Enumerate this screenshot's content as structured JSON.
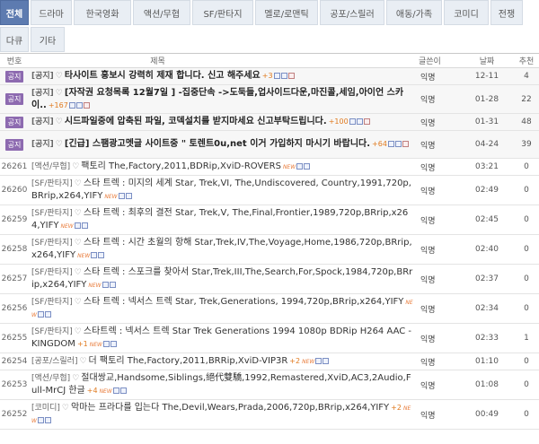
{
  "tabs": [
    [
      "전체",
      "드라마",
      "한국영화",
      "액션/무협",
      "SF/판타지",
      "멜로/로맨틱",
      "공포/스릴러",
      "애동/가족",
      "코미디",
      "전쟁"
    ],
    [
      "다큐",
      "기타"
    ]
  ],
  "header": {
    "no": "번호",
    "title": "제목",
    "author": "글쓴이",
    "date": "날짜",
    "views": "추천"
  },
  "rows": [
    {
      "no": "공지",
      "title": "타사이트 홍보시 강력히 제재 합니다. 신고 해주세요",
      "comments": "+3",
      "author": "익명",
      "date": "12-11",
      "views": "4",
      "notice": true
    },
    {
      "no": "공지",
      "title": "[자작권 요청목록 12월7일 ] -집중단속 ->도둑들,업사이드다운,마진콜,세임,아이언 스카이..",
      "comments": "+167",
      "author": "익명",
      "date": "01-28",
      "views": "22",
      "notice": true
    },
    {
      "no": "공지",
      "title": "시드파일중에 압축된 파일, 코덱설치를 받지마세요 신고부탁드립니다.",
      "comments": "+100",
      "author": "익명",
      "date": "01-31",
      "views": "48",
      "notice": true
    },
    {
      "no": "공지",
      "title": "[긴급] 스팸광고멧글 사이트중 \" 토렌트0u,net 이거 가입하지 마시기 바랍니다.",
      "comments": "+64",
      "author": "익명",
      "date": "04-24",
      "views": "39",
      "notice": true
    },
    {
      "no": "26261",
      "cat": "[액션/무협]",
      "title": "팩토리 The,Factory,2011,BDRip,XviD-ROVERS",
      "comments": "",
      "author": "익명",
      "date": "03:21",
      "views": "0"
    },
    {
      "no": "26260",
      "cat": "[SF/판타지]",
      "title": "스타 트렉 : 미지의 세계 Star, Trek,VI, The,Undiscovered, Country,1991,720p,BRrip,x264,YIFY",
      "comments": "",
      "author": "익명",
      "date": "02:49",
      "views": "0"
    },
    {
      "no": "26259",
      "cat": "[SF/판타지]",
      "title": "스타 트렉 : 최후의 결전 Star, Trek,V, The,Final,Frontier,1989,720p,BRrip,x264,YIFY",
      "comments": "",
      "author": "익명",
      "date": "02:45",
      "views": "0"
    },
    {
      "no": "26258",
      "cat": "[SF/판타지]",
      "title": "스타 트렉 : 시간 초월의 항해 Star,Trek,IV,The,Voyage,Home,1986,720p,BRrip,x264,YIFY",
      "comments": "",
      "author": "익명",
      "date": "02:40",
      "views": "0"
    },
    {
      "no": "26257",
      "cat": "[SF/판타지]",
      "title": "스타 트렉 : 스포크를 찾아서 Star,Trek,III,The,Search,For,Spock,1984,720p,BRrip,x264,YIFY",
      "comments": "",
      "author": "익명",
      "date": "02:37",
      "views": "0"
    },
    {
      "no": "26256",
      "cat": "[SF/판타지]",
      "title": "스타 트렉 : 넥서스 트렉 Star, Trek,Generations, 1994,720p,BRrip,x264,YIFY",
      "comments": "",
      "author": "익명",
      "date": "02:34",
      "views": "0"
    },
    {
      "no": "26255",
      "cat": "[SF/판타지]",
      "title": "스타트렉 : 넥서스 트렉 Star Trek Generations 1994 1080p BDRip H264 AAC - KINGDOM",
      "comments": "+1",
      "author": "익명",
      "date": "02:33",
      "views": "1"
    },
    {
      "no": "26254",
      "cat": "[공포/스릴러]",
      "title": "더 팩토리 The,Factory,2011,BRRip,XviD-VIP3R",
      "comments": "+2",
      "author": "익명",
      "date": "01:10",
      "views": "0"
    },
    {
      "no": "26253",
      "cat": "[액션/무협]",
      "title": "절대쌍교,Handsome,Siblings,絕代雙驕,1992,Remastered,XviD,AC3,2Audio,Full-MrCJ 한글",
      "comments": "+4",
      "author": "익명",
      "date": "01:08",
      "views": "0"
    },
    {
      "no": "26252",
      "cat": "[코미디]",
      "title": "악마는 프라다를 입는다 The,Devil,Wears,Prada,2006,720p,BRrip,x264,YIFY",
      "comments": "+2",
      "author": "익명",
      "date": "00:49",
      "views": "0"
    }
  ],
  "colors": {
    "active_tab": "#5d7bb0",
    "notice_badge": "#8d6ab0",
    "comment_count": "#e07a1f"
  }
}
